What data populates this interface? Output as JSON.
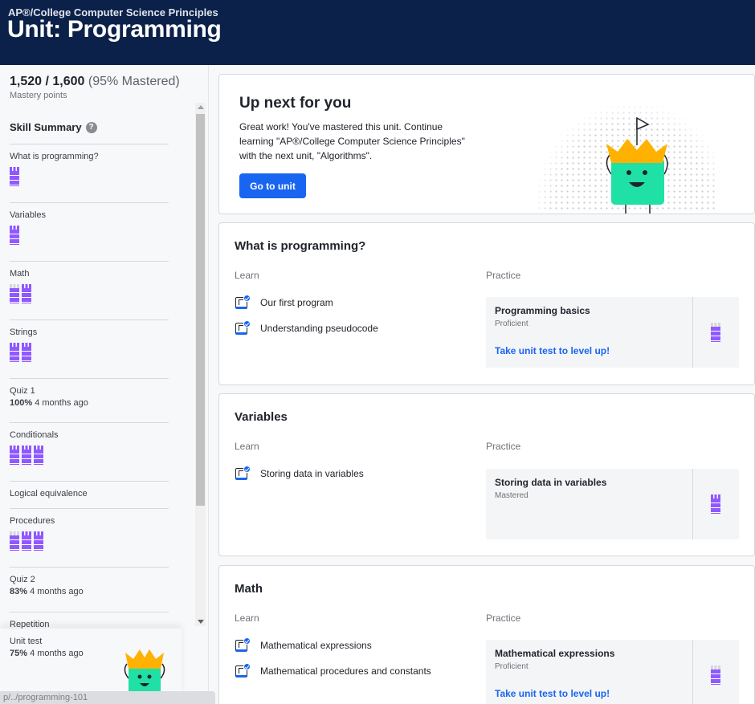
{
  "header": {
    "course": "AP®/College Computer Science Principles",
    "unit_title": "Unit: Programming"
  },
  "sidebar": {
    "points": "1,520 / 1,600",
    "mastered_pct": "(95% Mastered)",
    "points_caption": "Mastery points",
    "skill_summary": "Skill Summary",
    "skills": [
      {
        "label": "What is programming?",
        "bars": 1
      },
      {
        "label": "Variables",
        "bars": 1
      },
      {
        "label": "Math",
        "bars": 2
      },
      {
        "label": "Strings",
        "bars": 2
      },
      {
        "label": "Quiz 1",
        "score": "100%",
        "when": "4 months ago"
      },
      {
        "label": "Conditionals",
        "bars": 3
      },
      {
        "label": "Logical equivalence"
      },
      {
        "label": "Procedures",
        "bars": 3
      },
      {
        "label": "Quiz 2",
        "score": "83%",
        "when": "4 months ago"
      },
      {
        "label": "Repetition"
      }
    ],
    "unit_test": {
      "label": "Unit test",
      "score": "75%",
      "when": "4 months ago"
    },
    "status_url": "p/../programming-101"
  },
  "up_next": {
    "title": "Up next for you",
    "description": "Great work! You've mastered this unit. Continue learning \"AP®/College Computer Science Principles\" with the next unit, \"Algorithms\".",
    "button": "Go to unit"
  },
  "sections": [
    {
      "title": "What is programming?",
      "learn_label": "Learn",
      "practice_label": "Practice",
      "lessons": [
        "Our first program",
        "Understanding pseudocode"
      ],
      "practice": {
        "name": "Programming basics",
        "status": "Proficient",
        "link": "Take unit test to level up!"
      }
    },
    {
      "title": "Variables",
      "learn_label": "Learn",
      "practice_label": "Practice",
      "lessons": [
        "Storing data in variables"
      ],
      "practice": {
        "name": "Storing data in variables",
        "status": "Mastered",
        "link": ""
      }
    },
    {
      "title": "Math",
      "learn_label": "Learn",
      "practice_label": "Practice",
      "lessons": [
        "Mathematical expressions",
        "Mathematical procedures and constants"
      ],
      "practice": {
        "name": "Mathematical expressions",
        "status": "Proficient",
        "link": "Take unit test to level up!"
      }
    }
  ],
  "colors": {
    "header_bg": "#0b2149",
    "accent": "#1865f2",
    "mastery": "#9059ff",
    "mascot": "#1fe0a5",
    "crown": "#ffb100"
  }
}
